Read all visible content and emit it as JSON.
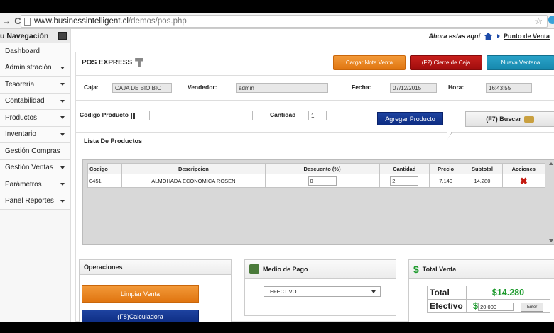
{
  "browser": {
    "url_host": "www.businessintelligent.cl",
    "url_path": "/demos/pos.php"
  },
  "sidebar": {
    "title": "u Navegación",
    "items": [
      {
        "label": "Dashboard",
        "caret": false
      },
      {
        "label": "Administración",
        "caret": true
      },
      {
        "label": "Tesoreria",
        "caret": true
      },
      {
        "label": "Contabilidad",
        "caret": true
      },
      {
        "label": "Productos",
        "caret": true
      },
      {
        "label": "Inventario",
        "caret": true
      },
      {
        "label": "Gestión Compras",
        "caret": false
      },
      {
        "label": "Gestión Ventas",
        "caret": true
      },
      {
        "label": "Parámetros",
        "caret": true
      },
      {
        "label": "Panel Reportes",
        "caret": true
      }
    ]
  },
  "breadcrumb": {
    "prefix": "Ahora estas aquí",
    "current": "Punto de Venta"
  },
  "pos": {
    "title": "POS EXPRESS",
    "buttons": {
      "cargar": "Cargar Nota Venta",
      "cierre": "(F2) Cierre de Caja",
      "nueva": "Nueva Ventana"
    },
    "caja_label": "Caja:",
    "caja_value": "CAJA DE BIO BIO",
    "vendedor_label": "Vendedor:",
    "vendedor_value": "admin",
    "fecha_label": "Fecha:",
    "fecha_value": "07/12/2015",
    "hora_label": "Hora:",
    "hora_value": "16:43:55",
    "codigo_label": "Codigo Producto",
    "codigo_value": "",
    "cantidad_label": "Cantidad",
    "cantidad_value": "1",
    "agregar": "Agregar Producto",
    "buscar": "(F7) Buscar"
  },
  "lista": {
    "title": "Lista De Productos",
    "columns": [
      "Codigo",
      "Descripcion",
      "Descuento (%)",
      "Cantidad",
      "Precio",
      "Subtotal",
      "Acciones"
    ],
    "rows": [
      {
        "codigo": "0451",
        "descripcion": "ALMOHADA ECONOMICA ROSEN",
        "descuento": "0",
        "cantidad": "2",
        "precio": "7.140",
        "subtotal": "14.280"
      }
    ]
  },
  "operaciones": {
    "title": "Operaciones",
    "limpiar": "Limpiar Venta",
    "calculadora": "(F8)Calculadora"
  },
  "medio_pago": {
    "title": "Medio de Pago",
    "selected": "EFECTIVO"
  },
  "total_venta": {
    "title": "Total Venta",
    "total_label": "Total",
    "total_value": "$14.280",
    "efectivo_label": "Efectivo",
    "efectivo_value": "20.000",
    "enter_button": "Enter"
  }
}
